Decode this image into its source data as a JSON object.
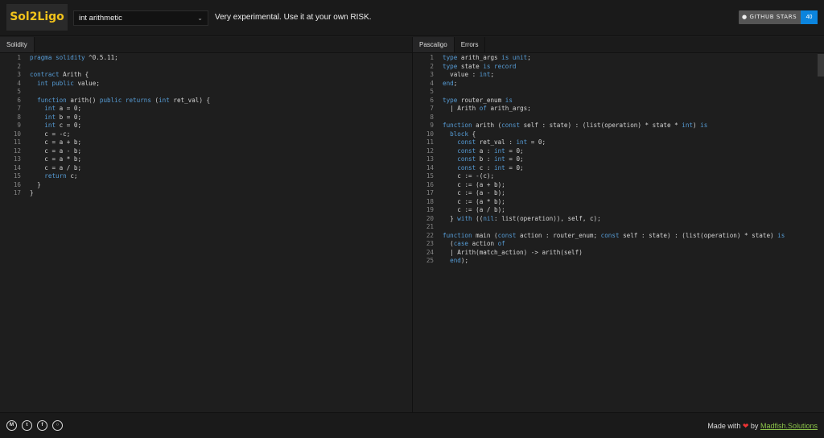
{
  "header": {
    "logo": "Sol2Ligo",
    "example_select": "int arithmetic",
    "warning": "Very experimental. Use it at your own RISK.",
    "github_label": "GITHUB STARS",
    "github_count": "40"
  },
  "left": {
    "tabs": [
      "Solidity"
    ],
    "lines": [
      {
        "n": "1",
        "t": "pragma solidity ^0.5.11;"
      },
      {
        "n": "2",
        "t": ""
      },
      {
        "n": "3",
        "t": "contract Arith {"
      },
      {
        "n": "4",
        "t": "  int public value;"
      },
      {
        "n": "5",
        "t": ""
      },
      {
        "n": "6",
        "t": "  function arith() public returns (int ret_val) {"
      },
      {
        "n": "7",
        "t": "    int a = 0;"
      },
      {
        "n": "8",
        "t": "    int b = 0;"
      },
      {
        "n": "9",
        "t": "    int c = 0;"
      },
      {
        "n": "10",
        "t": "    c = -c;"
      },
      {
        "n": "11",
        "t": "    c = a + b;"
      },
      {
        "n": "12",
        "t": "    c = a - b;"
      },
      {
        "n": "13",
        "t": "    c = a * b;"
      },
      {
        "n": "14",
        "t": "    c = a / b;"
      },
      {
        "n": "15",
        "t": "    return c;"
      },
      {
        "n": "16",
        "t": "  }"
      },
      {
        "n": "17",
        "t": "}"
      }
    ]
  },
  "right": {
    "tabs": [
      "Pascaligo",
      "Errors"
    ],
    "lines": [
      {
        "n": "1",
        "t": "type arith_args is unit;"
      },
      {
        "n": "2",
        "t": "type state is record"
      },
      {
        "n": "3",
        "t": "  value : int;"
      },
      {
        "n": "4",
        "t": "end;"
      },
      {
        "n": "5",
        "t": ""
      },
      {
        "n": "6",
        "t": "type router_enum is"
      },
      {
        "n": "7",
        "t": "  | Arith of arith_args;"
      },
      {
        "n": "8",
        "t": ""
      },
      {
        "n": "9",
        "t": "function arith (const self : state) : (list(operation) * state * int) is"
      },
      {
        "n": "10",
        "t": "  block {"
      },
      {
        "n": "11",
        "t": "    const ret_val : int = 0;"
      },
      {
        "n": "12",
        "t": "    const a : int = 0;"
      },
      {
        "n": "13",
        "t": "    const b : int = 0;"
      },
      {
        "n": "14",
        "t": "    const c : int = 0;"
      },
      {
        "n": "15",
        "t": "    c := -(c);"
      },
      {
        "n": "16",
        "t": "    c := (a + b);"
      },
      {
        "n": "17",
        "t": "    c := (a - b);"
      },
      {
        "n": "18",
        "t": "    c := (a * b);"
      },
      {
        "n": "19",
        "t": "    c := (a / b);"
      },
      {
        "n": "20",
        "t": "  } with ((nil: list(operation)), self, c);"
      },
      {
        "n": "21",
        "t": ""
      },
      {
        "n": "22",
        "t": "function main (const action : router_enum; const self : state) : (list(operation) * state) is"
      },
      {
        "n": "23",
        "t": "  (case action of"
      },
      {
        "n": "24",
        "t": "  | Arith(match_action) -> arith(self)"
      },
      {
        "n": "25",
        "t": "  end);"
      }
    ]
  },
  "footer": {
    "social_icons": [
      "medium-icon",
      "twitter-icon",
      "facebook-icon",
      "github-icon"
    ],
    "social_glyphs": [
      "M",
      "t",
      "f",
      "○"
    ],
    "made_with": "Made with",
    "heart": "❤",
    "by": "by",
    "link": "Madfish.Solutions"
  }
}
